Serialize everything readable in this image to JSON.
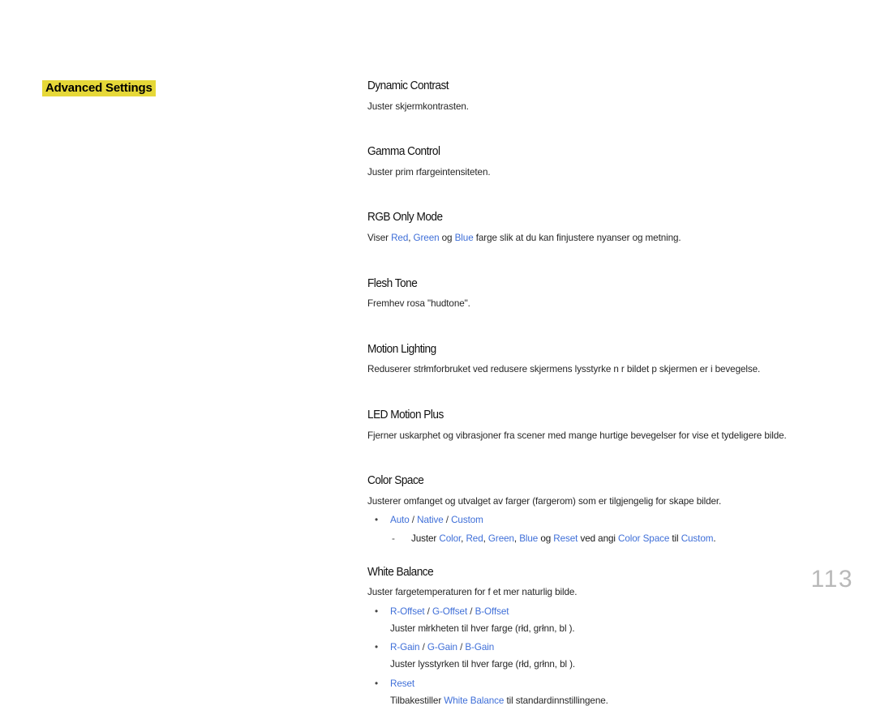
{
  "document": {
    "heading": "Advanced Settings",
    "page_number": "113",
    "highlight_color": "#e6d838",
    "accent_color": "#3f6fd8"
  },
  "sections": [
    {
      "title": "Dynamic Contrast",
      "desc": "Juster skjermkontrasten."
    },
    {
      "title": "Gamma Control",
      "desc": "Juster prim rfargeintensiteten."
    },
    {
      "title": "RGB Only Mode",
      "desc_prefix": "Viser ",
      "term_red": "Red",
      "desc_sep1": ", ",
      "term_green": "Green",
      "desc_sep2": " og ",
      "term_blue": "Blue",
      "desc_suffix": " farge slik at du kan finjustere nyanser og metning."
    },
    {
      "title": "Flesh Tone",
      "desc": "Fremhev rosa \"hudtone\"."
    },
    {
      "title": "Motion Lighting",
      "desc": "Reduserer strłmforbruket ved   redusere skjermens lysstyrke n r bildet p  skjermen er i bevegelse."
    },
    {
      "title": "LED Motion Plus",
      "desc": "Fjerner uskarphet og vibrasjoner fra scener med mange hurtige bevegelser for   vise et tydeligere bilde."
    },
    {
      "title": "Color Space",
      "desc": "Justerer omfanget og utvalget av farger (fargerom) som er tilgjengelig for   skape bilder.",
      "bullet": {
        "dot": "•",
        "opt_auto": "Auto",
        "slash1": " / ",
        "opt_native": "Native",
        "slash2": " / ",
        "opt_custom": "Custom"
      },
      "sub": {
        "dash": "-",
        "t1": "Juster ",
        "t_color": "Color",
        "t2": ", ",
        "t_red": "Red",
        "t3": ", ",
        "t_green": "Green",
        "t4": ", ",
        "t_blue": "Blue",
        "t5": " og ",
        "t_reset": "Reset",
        "t6": " ved   angi ",
        "t_colorspace": "Color Space",
        "t7": " til ",
        "t_custom": "Custom",
        "t8": "."
      }
    },
    {
      "title": "White Balance",
      "desc": "Juster fargetemperaturen for   f  et mer naturlig bilde.",
      "bullets": [
        {
          "dot": "•",
          "label_1": "R-Offset",
          "slash_1": " / ",
          "label_2": "G-Offset",
          "slash_2": " / ",
          "label_3": "B-Offset",
          "desc": "Juster młrkheten til hver farge (rłd, grłnn, bl )."
        },
        {
          "dot": "•",
          "label_1": "R-Gain",
          "slash_1": " / ",
          "label_2": "G-Gain",
          "slash_2": " / ",
          "label_3": "B-Gain",
          "desc": "Juster lysstyrken til hver farge (rłd, grłnn, bl )."
        }
      ],
      "reset_bullet": {
        "dot": "•",
        "label": "Reset",
        "desc_prefix": "Tilbakestiller ",
        "term": "White Balance",
        "desc_suffix": " til standardinnstillingene."
      }
    }
  ]
}
